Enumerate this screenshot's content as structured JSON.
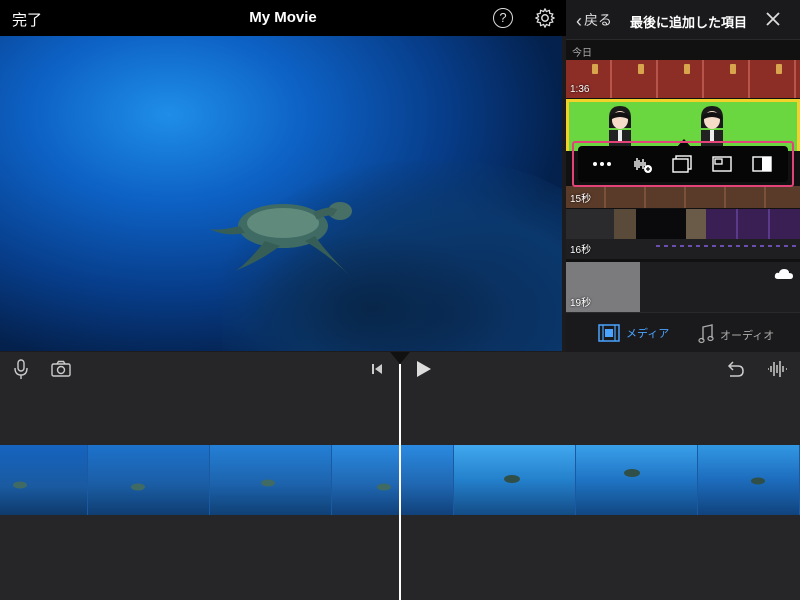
{
  "topbar": {
    "done_label": "完了",
    "title": "My Movie",
    "help_label": "?"
  },
  "panel": {
    "back_label": "戻る",
    "title": "最後に追加した項目",
    "section_today": "今日",
    "clips": [
      {
        "duration": "1:36"
      },
      {
        "duration": ""
      },
      {
        "duration": "15秒"
      },
      {
        "duration": "16秒"
      },
      {
        "duration": "19秒"
      }
    ],
    "actions": [
      "more-icon",
      "audio-add-icon",
      "cutaway-icon",
      "picture-in-picture-icon",
      "split-screen-icon"
    ],
    "tabs": {
      "media": "メディア",
      "audio": "オーディオ"
    }
  },
  "colors": {
    "accent": "#4aa3ff",
    "highlight": "#e2447a",
    "selected_clip_border": "#f2d12a",
    "green_screen": "#6ad640"
  }
}
